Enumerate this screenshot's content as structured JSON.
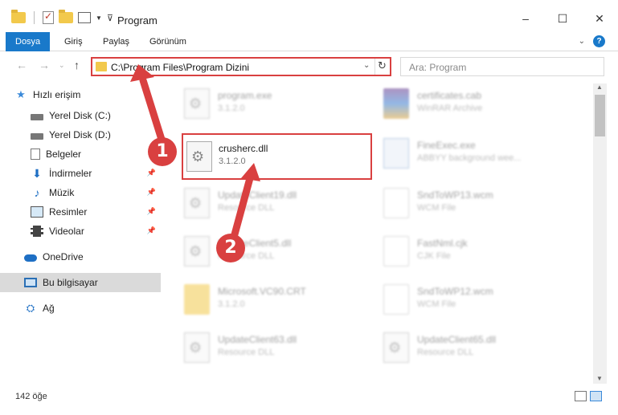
{
  "window": {
    "title": "Program",
    "controls": {
      "minimize": "–",
      "maximize": "☐",
      "close": "✕"
    }
  },
  "ribbon": {
    "tabs": [
      {
        "label": "Dosya",
        "active": true
      },
      {
        "label": "Giriş"
      },
      {
        "label": "Paylaş"
      },
      {
        "label": "Görünüm"
      }
    ],
    "help": "?"
  },
  "nav": {
    "address": "C:\\Program Files\\Program Dizini",
    "search_placeholder": "Ara: Program"
  },
  "sidebar": {
    "items": [
      {
        "label": "Hızlı erişim",
        "icon": "star-icon"
      },
      {
        "label": "Yerel Disk (C:)",
        "icon": "disk-icon"
      },
      {
        "label": "Yerel Disk (D:)",
        "icon": "disk-icon"
      },
      {
        "label": "Belgeler",
        "icon": "document-icon"
      },
      {
        "label": "İndirmeler",
        "icon": "download-icon",
        "pinned": true
      },
      {
        "label": "Müzik",
        "icon": "music-icon",
        "pinned": true
      },
      {
        "label": "Resimler",
        "icon": "pictures-icon",
        "pinned": true
      },
      {
        "label": "Videolar",
        "icon": "video-icon",
        "pinned": true
      },
      {
        "label": "OneDrive",
        "icon": "cloud-icon"
      },
      {
        "label": "Bu bilgisayar",
        "icon": "computer-icon",
        "selected": true
      },
      {
        "label": "Ağ",
        "icon": "network-icon"
      }
    ]
  },
  "files": [
    {
      "name": "program.exe",
      "meta": "3.1.2.0",
      "icon": "gear-file-icon"
    },
    {
      "name": "certificates.cab",
      "meta": "WinRAR Archive",
      "icon": "archive-icon"
    },
    {
      "name": "crusherc.dll",
      "meta": "3.1.2.0",
      "icon": "dll-icon",
      "highlighted": true
    },
    {
      "name": "FineExec.exe",
      "meta": "ABBYY background wee...",
      "icon": "exe-icon"
    },
    {
      "name": "UpdateClient19.dll",
      "meta": "Resource DLL",
      "icon": "dll-icon"
    },
    {
      "name": "SndToWP13.wcm",
      "meta": "WCM File",
      "icon": "file-icon"
    },
    {
      "name": "UpdateClient5.dll",
      "meta": "Resource DLL",
      "icon": "dll-icon"
    },
    {
      "name": "FastNml.cjk",
      "meta": "CJK File",
      "icon": "file-icon"
    },
    {
      "name": "Microsoft.VC90.CRT",
      "meta": "3.1.2.0",
      "icon": "folder-icon"
    },
    {
      "name": "SndToWP12.wcm",
      "meta": "WCM File",
      "icon": "file-icon"
    },
    {
      "name": "UpdateClient63.dll",
      "meta": "Resource DLL",
      "icon": "dll-icon"
    },
    {
      "name": "UpdateClient65.dll",
      "meta": "Resource DLL",
      "icon": "dll-icon"
    }
  ],
  "status": {
    "count": "142 öğe"
  },
  "annotations": {
    "step1": "1",
    "step2": "2"
  },
  "colors": {
    "accent": "#1979ca",
    "annotation": "#d94040"
  }
}
